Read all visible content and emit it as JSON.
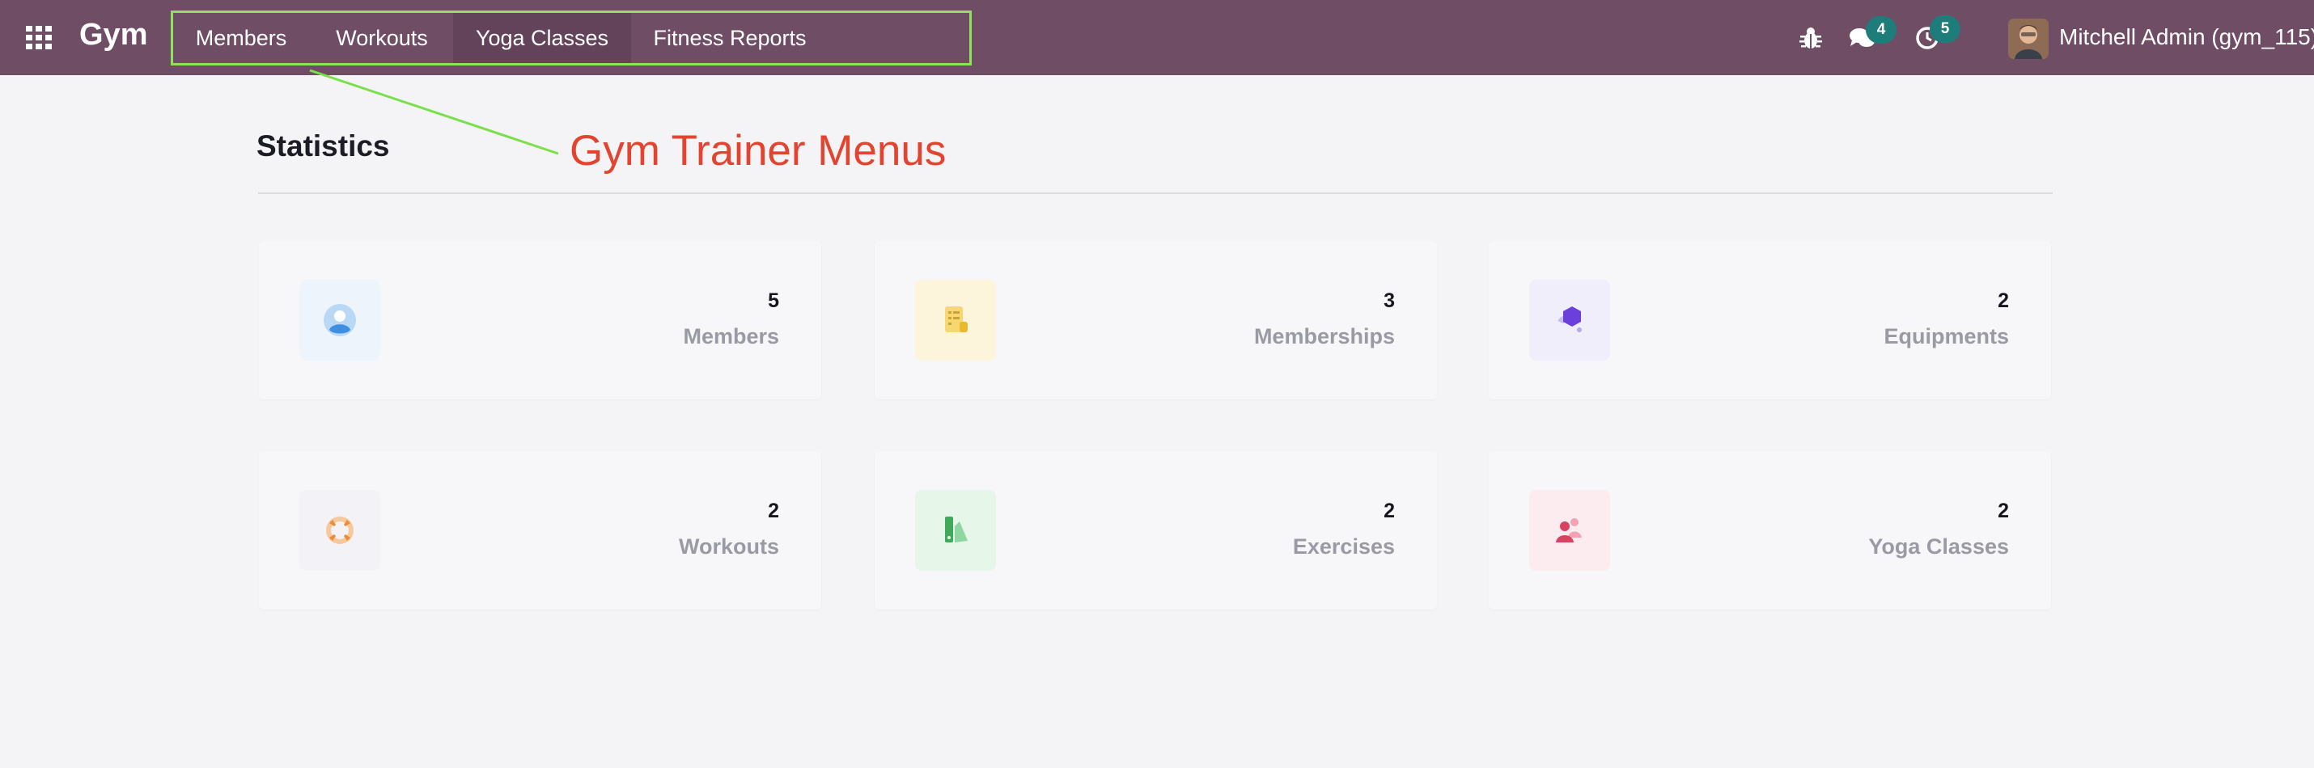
{
  "navbar": {
    "brand": "Gym",
    "menu": [
      {
        "label": "Members"
      },
      {
        "label": "Workouts"
      },
      {
        "label": "Yoga Classes"
      },
      {
        "label": "Fitness Reports"
      }
    ],
    "messages_count": "4",
    "activities_count": "5",
    "user": "Mitchell Admin (gym_115)"
  },
  "page": {
    "title": "Statistics",
    "annotation": "Gym Trainer Menus"
  },
  "stats": [
    {
      "value": "5",
      "label": "Members",
      "icon": "user-circle-icon",
      "tile_color": "#eef4fb"
    },
    {
      "value": "3",
      "label": "Memberships",
      "icon": "membership-card-icon",
      "tile_color": "#fcf5dc"
    },
    {
      "value": "2",
      "label": "Equipments",
      "icon": "cube-icon",
      "tile_color": "#f1eefb"
    },
    {
      "value": "2",
      "label": "Workouts",
      "icon": "lifebuoy-icon",
      "tile_color": "#f3f2f6"
    },
    {
      "value": "2",
      "label": "Exercises",
      "icon": "exercise-icon",
      "tile_color": "#e6f7e9"
    },
    {
      "value": "2",
      "label": "Yoga Classes",
      "icon": "group-icon",
      "tile_color": "#fcecef"
    }
  ],
  "colors": {
    "navbar": "#6f4d65",
    "annotation": "#e2442f",
    "highlight_box": "#8ee35a",
    "badge": "#1e7d7b"
  }
}
